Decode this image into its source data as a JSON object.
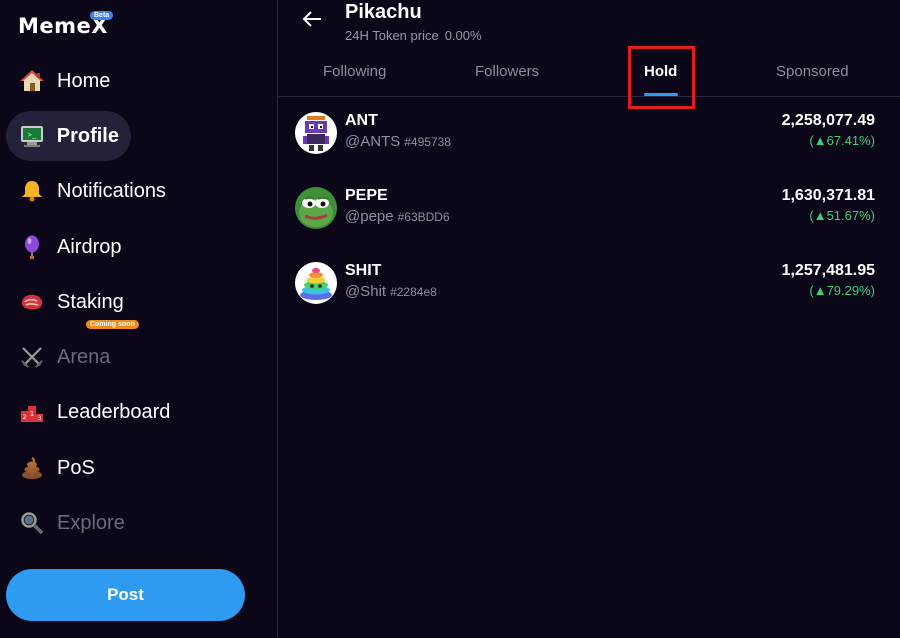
{
  "app": {
    "logo": "MemeX",
    "beta_badge": "Beta"
  },
  "sidebar": {
    "items": [
      {
        "label": "Home",
        "icon": "house-icon"
      },
      {
        "label": "Profile",
        "icon": "computer-icon",
        "active": true
      },
      {
        "label": "Notifications",
        "icon": "bell-icon"
      },
      {
        "label": "Airdrop",
        "icon": "balloon-icon"
      },
      {
        "label": "Staking",
        "icon": "meat-icon"
      },
      {
        "label": "Arena",
        "icon": "crossed-swords-icon",
        "disabled": true,
        "badge": "Coming soon"
      },
      {
        "label": "Leaderboard",
        "icon": "podium-icon"
      },
      {
        "label": "PoS",
        "icon": "poop-icon"
      },
      {
        "label": "Explore",
        "icon": "magnifier-icon",
        "disabled": true
      }
    ],
    "post_label": "Post"
  },
  "header": {
    "title": "Pikachu",
    "subtitle_label": "24H Token price",
    "subtitle_value": "0.00%"
  },
  "tabs": [
    {
      "label": "Following"
    },
    {
      "label": "Followers"
    },
    {
      "label": "Hold",
      "active": true
    },
    {
      "label": "Sponsored"
    }
  ],
  "holdings": [
    {
      "name": "ANT",
      "handle": "@ANTS",
      "id": "#495738",
      "value": "2,258,077.49",
      "change": "(▲67.41%)",
      "icon": "pixel-ant-avatar"
    },
    {
      "name": "PEPE",
      "handle": "@pepe",
      "id": "#63BDD6",
      "value": "1,630,371.81",
      "change": "(▲51.67%)",
      "icon": "pepe-frog-avatar"
    },
    {
      "name": "SHIT",
      "handle": "@Shit",
      "id": "#2284e8",
      "value": "1,257,481.95",
      "change": "(▲79.29%)",
      "icon": "rainbow-poop-avatar"
    }
  ],
  "colors": {
    "background": "#0b0718",
    "accent": "#2f9bf0",
    "positive": "#3ecf7c",
    "highlight": "#e01e1e"
  }
}
